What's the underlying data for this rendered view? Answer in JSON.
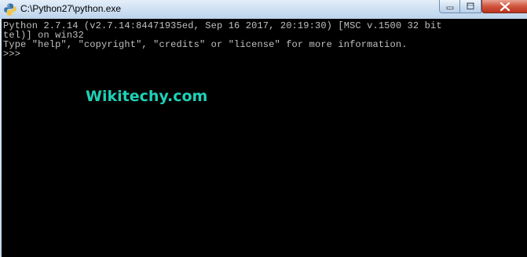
{
  "window": {
    "title": "C:\\Python27\\python.exe",
    "app_icon": "python-icon",
    "controls": {
      "minimize": "minimize-icon",
      "maximize": "maximize-icon",
      "close": "close-icon"
    }
  },
  "console": {
    "line1": "Python 2.7.14 (v2.7.14:84471935ed, Sep 16 2017, 20:19:30) [MSC v.1500 32 bit",
    "line2": "tel)] on win32",
    "line3": "Type \"help\", \"copyright\", \"credits\" or \"license\" for more information.",
    "prompt": ">>>"
  },
  "watermark": {
    "text": "Wikitechy.com",
    "color": "#1fd1b7"
  },
  "colors": {
    "console_bg": "#000000",
    "console_fg": "#c0c0c0"
  }
}
